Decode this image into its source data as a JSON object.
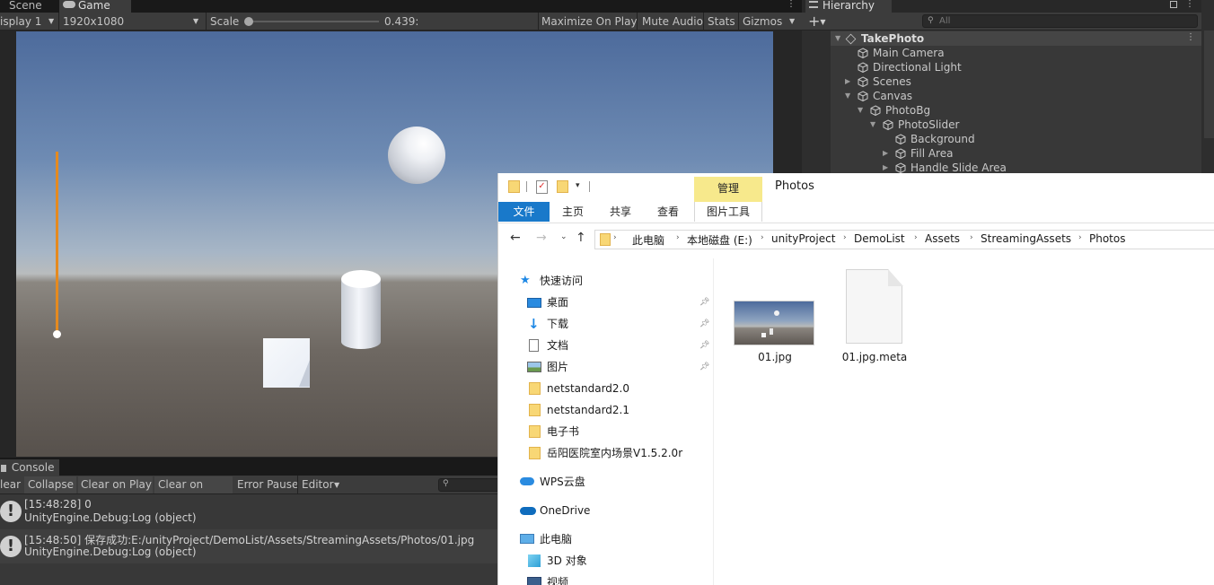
{
  "scene_tab": "Scene",
  "game_tab": "Game",
  "game_toolbar": {
    "display": "isplay 1",
    "resolution": "1920x1080",
    "scale_label": "Scale",
    "scale_value": "0.439:",
    "maximize": "Maximize On Play",
    "mute": "Mute Audio",
    "stats": "Stats",
    "gizmos": "Gizmos"
  },
  "hierarchy": {
    "tab": "Hierarchy",
    "search_placeholder": "All",
    "items": [
      {
        "label": "TakePhoto"
      },
      {
        "label": "Main Camera"
      },
      {
        "label": "Directional Light"
      },
      {
        "label": "Scenes"
      },
      {
        "label": "Canvas"
      },
      {
        "label": "PhotoBg"
      },
      {
        "label": "PhotoSlider"
      },
      {
        "label": "Background"
      },
      {
        "label": "Fill Area"
      },
      {
        "label": "Handle Slide Area"
      }
    ]
  },
  "console": {
    "tab": "Console",
    "toolbar": {
      "clear": "lear",
      "collapse": "Collapse",
      "clear_on_play": "Clear on Play",
      "clear_on_build": "Clear on Build",
      "error_pause": "Error Pause",
      "editor": "Editor"
    },
    "logs": [
      {
        "line1": "[15:48:28] 0",
        "line2": "UnityEngine.Debug:Log (object)"
      },
      {
        "line1": "[15:48:50] 保存成功:E:/unityProject/DemoList/Assets/StreamingAssets/Photos/01.jpg",
        "line2": "UnityEngine.Debug:Log (object)"
      }
    ]
  },
  "explorer": {
    "manage_tab": "管理",
    "title": "Photos",
    "tabs": {
      "file": "文件",
      "home": "主页",
      "share": "共享",
      "view": "查看",
      "picture_tools": "图片工具"
    },
    "breadcrumb": [
      "此电脑",
      "本地磁盘 (E:)",
      "unityProject",
      "DemoList",
      "Assets",
      "StreamingAssets",
      "Photos"
    ],
    "nav": {
      "quick_access": "快速访问",
      "desktop": "桌面",
      "downloads": "下载",
      "documents": "文档",
      "pictures": "图片",
      "folders": [
        "netstandard2.0",
        "netstandard2.1",
        "电子书",
        "岳阳医院室内场景V1.5.2.0r"
      ],
      "wps": "WPS云盘",
      "onedrive": "OneDrive",
      "this_pc": "此电脑",
      "objects3d": "3D 对象",
      "videos": "视频"
    },
    "files": [
      {
        "name": "01.jpg"
      },
      {
        "name": "01.jpg.meta"
      }
    ]
  },
  "colors": {
    "unity_panel": "#3c3c3c",
    "unity_dark": "#191919",
    "slider_orange": "#e58a1f",
    "explorer_blue": "#1979ca",
    "manage_yellow": "#f7e98c"
  }
}
